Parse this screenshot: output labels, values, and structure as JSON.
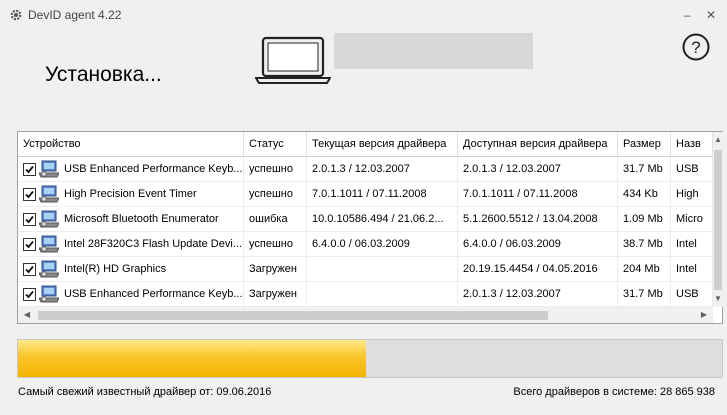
{
  "window": {
    "title": "DevID agent 4.22",
    "icon": "gear-icon",
    "minimize_symbol": "–",
    "close_symbol": "✕"
  },
  "header": {
    "heading": "Установка...",
    "help_icon": "help-icon"
  },
  "table": {
    "columns": [
      "Устройство",
      "Статус",
      "Текущая версия драйвера",
      "Доступная версия драйвера",
      "Размер",
      "Назв"
    ],
    "rows": [
      {
        "checked": true,
        "device": "USB Enhanced Performance Keyb...",
        "status": "успешно",
        "current": "2.0.1.3 / 12.03.2007",
        "available": "2.0.1.3 / 12.03.2007",
        "size": "31.7 Mb",
        "name": "USB"
      },
      {
        "checked": true,
        "device": "High Precision Event Timer",
        "status": "успешно",
        "current": "7.0.1.1011 / 07.11.2008",
        "available": "7.0.1.1011 / 07.11.2008",
        "size": "434 Kb",
        "name": "High"
      },
      {
        "checked": true,
        "device": "Microsoft Bluetooth Enumerator",
        "status": "ошибка",
        "current": "10.0.10586.494 / 21.06.2...",
        "available": "5.1.2600.5512 / 13.04.2008",
        "size": "1.09 Mb",
        "name": "Micro"
      },
      {
        "checked": true,
        "device": "Intel 28F320C3 Flash Update Devi...",
        "status": "успешно",
        "current": "6.4.0.0 / 06.03.2009",
        "available": "6.4.0.0 / 06.03.2009",
        "size": "38.7 Mb",
        "name": "Intel"
      },
      {
        "checked": true,
        "device": "Intel(R) HD Graphics",
        "status": "Загружен",
        "current": "",
        "available": "20.19.15.4454 / 04.05.2016",
        "size": "204 Mb",
        "name": "Intel"
      },
      {
        "checked": true,
        "device": "USB Enhanced Performance Keyb...",
        "status": "Загружен",
        "current": "",
        "available": "2.0.1.3 / 12.03.2007",
        "size": "31.7 Mb",
        "name": "USB"
      }
    ]
  },
  "progress": {
    "fraction": 0.495
  },
  "footer": {
    "left": "Самый свежий известный драйвер от: 09.06.2016",
    "right": "Всего драйверов в системе: 28 865 938"
  }
}
